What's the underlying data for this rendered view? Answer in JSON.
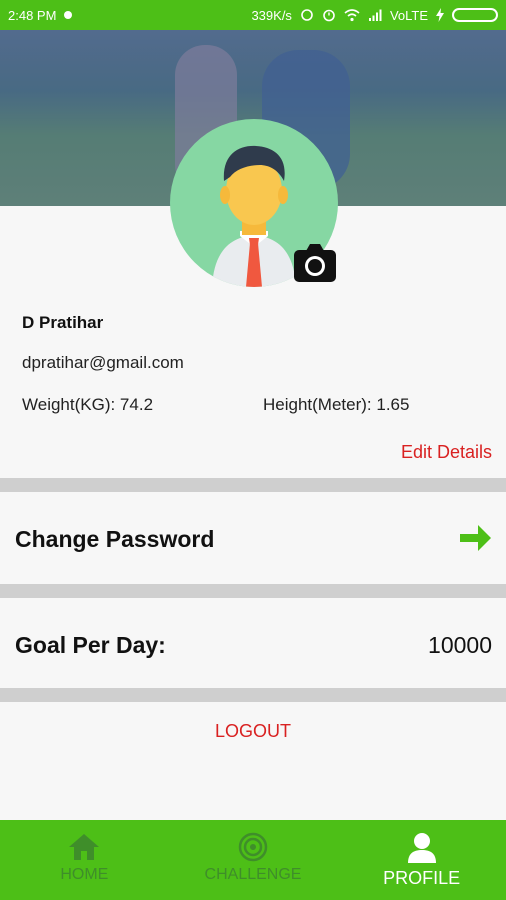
{
  "status_bar": {
    "time": "2:48 PM",
    "speed": "339K/s",
    "network": "VoLTE"
  },
  "profile": {
    "name": "D Pratihar",
    "email": "dpratihar@gmail.com",
    "weight": "Weight(KG): 74.2",
    "height": "Height(Meter): 1.65",
    "edit_label": "Edit Details"
  },
  "settings": {
    "change_password_label": "Change Password",
    "goal_label": "Goal Per Day:",
    "goal_value": "10000",
    "logout_label": "LOGOUT"
  },
  "bottom_nav": {
    "items": [
      {
        "label": "HOME",
        "icon": "home-icon",
        "active": false
      },
      {
        "label": "CHALLENGE",
        "icon": "challenge-icon",
        "active": false
      },
      {
        "label": "PROFILE",
        "icon": "profile-icon",
        "active": true
      }
    ]
  },
  "colors": {
    "brand_green": "#4dbf17",
    "accent_red": "#d92121",
    "arrow_green": "#4dbf17"
  }
}
